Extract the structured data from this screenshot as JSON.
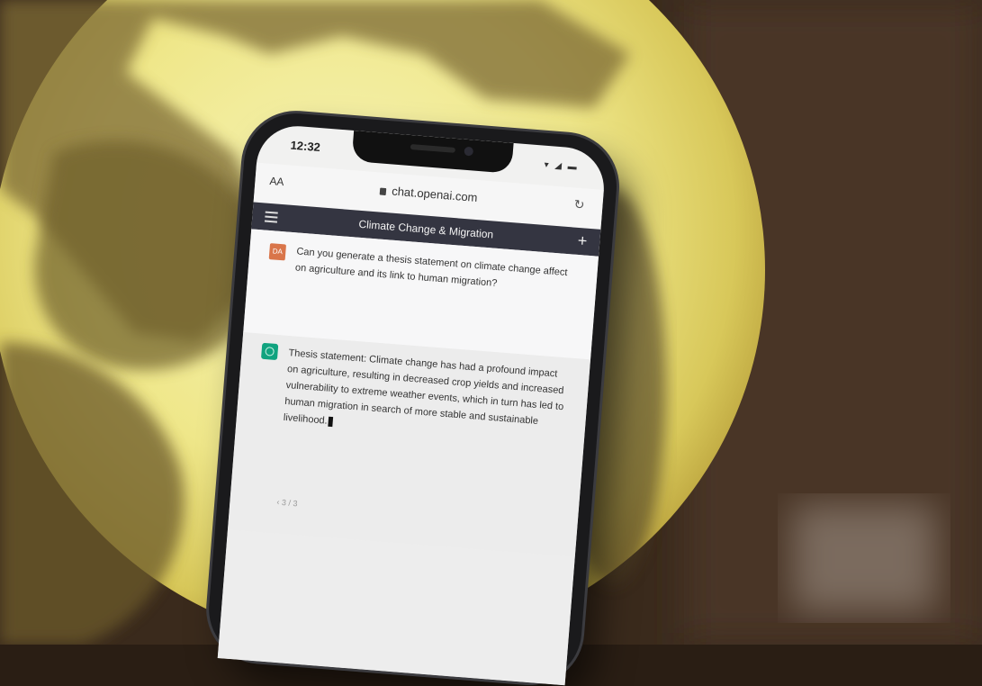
{
  "phone": {
    "status_time": "12:32",
    "status_icons": "▾ ◢ ▬"
  },
  "browser": {
    "text_size_label": "AA",
    "url": "chat.openai.com",
    "reload_icon": "reload-icon"
  },
  "chat": {
    "title": "Climate Change & Migration",
    "new_chat_icon": "plus-icon",
    "menu_icon": "menu-icon",
    "user_avatar_initials": "DA",
    "user_prompt": "Can you generate a thesis statement on climate change affect on agriculture and its link to human migration?",
    "assistant_response": "Thesis statement: Climate change has had a profound impact on agriculture, resulting in decreased crop yields and increased vulnerability to extreme weather events, which in turn has led to human migration in search of more stable and sustainable livelihood.",
    "pager": "‹ 3 / 3"
  },
  "colors": {
    "header_bg": "#343541",
    "user_avatar": "#d9754a",
    "assistant_avatar": "#10a37f",
    "lamp_glow": "#f6f2a6"
  }
}
